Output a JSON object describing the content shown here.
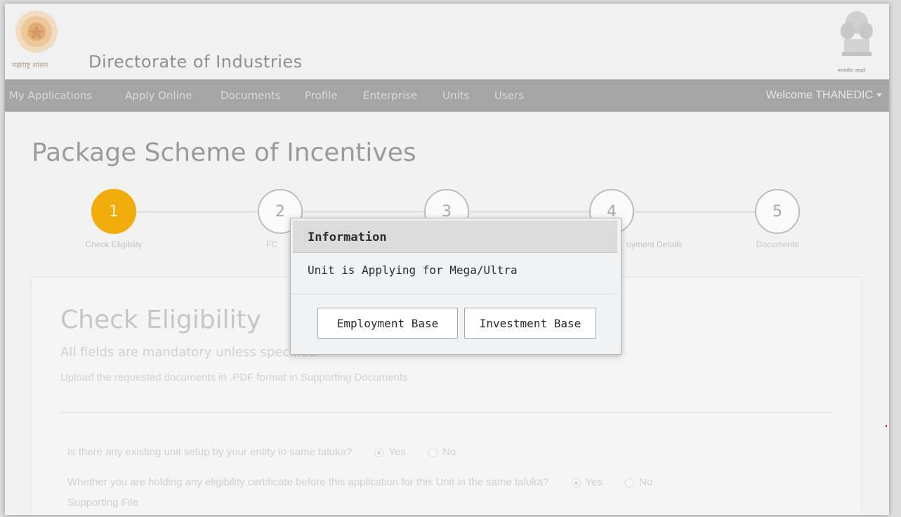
{
  "header": {
    "left_emblem_caption": "महाराष्ट्र शासन",
    "site_title": "Directorate of Industries",
    "right_emblem_caption": "सत्यमेव जयते"
  },
  "nav": {
    "items": [
      "My Applications",
      "Apply Online",
      "Documents",
      "Profile",
      "Enterprise",
      "Units",
      "Users"
    ],
    "welcome": "Welcome THANEDIC"
  },
  "page": {
    "title": "Package Scheme of Incentives"
  },
  "wizard": {
    "steps": [
      {
        "number": "1",
        "label": "Check Eligiblity",
        "active": true
      },
      {
        "number": "2",
        "label": "FC",
        "active": false
      },
      {
        "number": "3",
        "label": "",
        "active": false
      },
      {
        "number": "4",
        "label": "oyment Details",
        "active": false
      },
      {
        "number": "5",
        "label": "Documents",
        "active": false
      }
    ]
  },
  "form": {
    "title": "Check Eligibility",
    "subtitle": "All fields are mandatory unless specified",
    "note": "Upload the requested documents in .PDF format in Supporting Documents",
    "questions": [
      {
        "text": "Is there any existing unit setup by your entity in same taluka?",
        "yes": "Yes",
        "no": "No",
        "selected": "Yes"
      },
      {
        "text": "Whether you are holding any eligibility certificate before this application for this Unit in the same taluka?",
        "yes": "Yes",
        "no": "No",
        "selected": "Yes"
      }
    ],
    "supporting_label": "Supporting File"
  },
  "modal": {
    "title": "Information",
    "message": "Unit is Applying for Mega/Ultra",
    "buttons": [
      "Employment Base",
      "Investment Base"
    ]
  },
  "colors": {
    "active_step": "#f0ac0a",
    "navbar": "#a5a5a5"
  }
}
